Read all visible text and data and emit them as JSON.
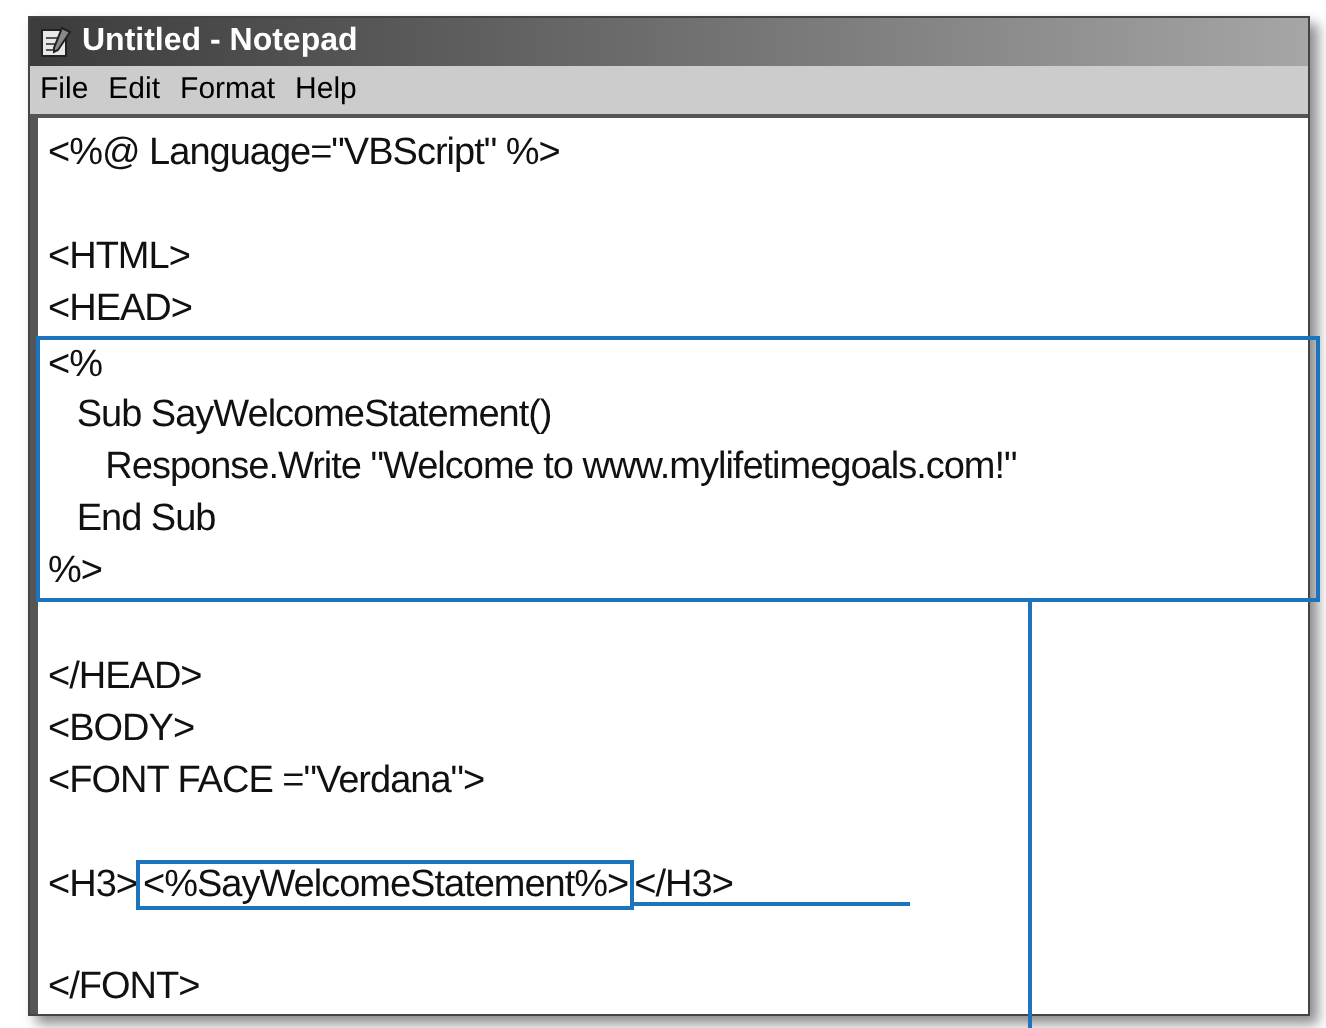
{
  "window": {
    "title": "Untitled - Notepad"
  },
  "menu": [
    "File",
    "Edit",
    "Format",
    "Help"
  ],
  "code": [
    {
      "kind": "line",
      "text": "<%@ Language=\"VBScript\" %>"
    },
    {
      "kind": "blank"
    },
    {
      "kind": "line",
      "text": "<HTML>"
    },
    {
      "kind": "line",
      "text": "<HEAD>"
    },
    {
      "kind": "callout_block",
      "lines": [
        "<%",
        "   Sub SayWelcomeStatement()",
        "      Response.Write \"Welcome to www.mylifetimegoals.com!\"",
        "   End Sub",
        "%>"
      ]
    },
    {
      "kind": "blank"
    },
    {
      "kind": "line",
      "text": "</HEAD>"
    },
    {
      "kind": "line",
      "text": "<BODY>"
    },
    {
      "kind": "line",
      "text": "<FONT FACE =\"Verdana\">"
    },
    {
      "kind": "blank"
    },
    {
      "kind": "callout_inline",
      "before": "<H3>",
      "boxed": "<%SayWelcomeStatement%>",
      "after": "</H3>"
    },
    {
      "kind": "blank"
    },
    {
      "kind": "line",
      "text": "</FONT>"
    }
  ]
}
